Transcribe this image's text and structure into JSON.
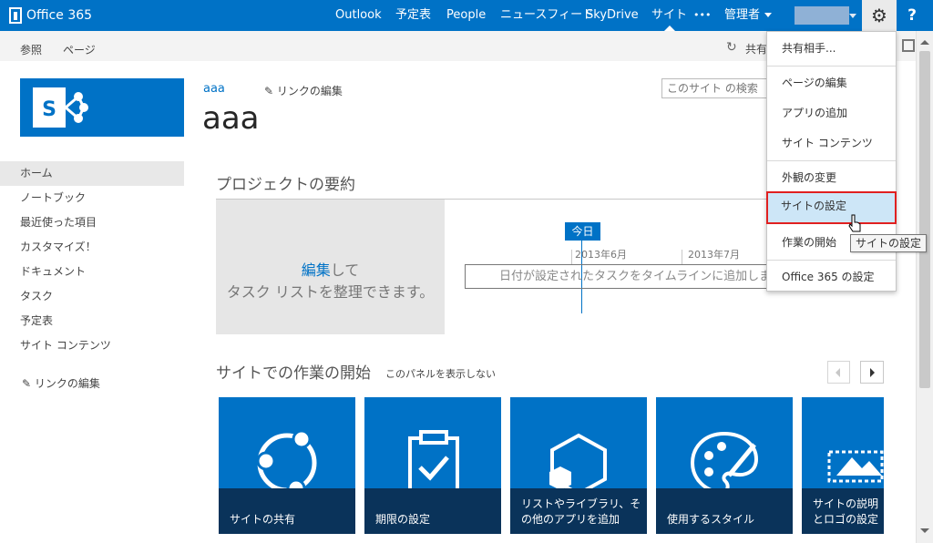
{
  "suite_bar": {
    "brand": "Office 365",
    "nav": [
      "Outlook",
      "予定表",
      "People",
      "ニュースフィード",
      "SkyDrive",
      "サイト",
      "•••"
    ],
    "active_nav": "サイト",
    "admin_label": "管理者",
    "help_label": "?"
  },
  "ribbon": {
    "tabs": [
      "参照",
      "ページ"
    ],
    "share_label": "共有"
  },
  "site": {
    "breadcrumb": "aaa",
    "edit_links": "リンクの編集",
    "title": "aaa",
    "search_placeholder": "このサイト の検索"
  },
  "quick_launch": {
    "items": [
      "ホーム",
      "ノートブック",
      "最近使った項目",
      "カスタマイズ！",
      "ドキュメント",
      "タスク",
      "予定表",
      "サイト コンテンツ"
    ],
    "selected": "ホーム",
    "edit_links": "リンクの編集"
  },
  "project_summary": {
    "heading": "プロジェクトの要約",
    "edit_link": "編集",
    "edit_suffix": "して",
    "line2": "タスク リストを整理できます。",
    "today_label": "今日",
    "months": [
      "2013年6月",
      "2013年7月"
    ],
    "timeline_text": "日付が設定されたタスクをタイムラインに追加しましょう。"
  },
  "getting_started": {
    "heading": "サイトでの作業の開始",
    "hide_link": "このパネルを表示しない",
    "tiles": [
      {
        "label": "サイトの共有",
        "icon": "share-site-icon"
      },
      {
        "label": "期限の設定",
        "icon": "clipboard-check-icon"
      },
      {
        "label": "リストやライブラリ、その他のアプリを追加",
        "icon": "add-apps-icon"
      },
      {
        "label": "使用するスタイル",
        "icon": "palette-brush-icon"
      },
      {
        "label": "サイトの説明とロゴの設定",
        "icon": "picture-frame-icon"
      }
    ]
  },
  "settings_menu": {
    "items": [
      "共有相手...",
      "ページの編集",
      "アプリの追加",
      "サイト コンテンツ",
      "外観の変更",
      "サイトの設定",
      "作業の開始",
      "Office 365 の設定"
    ],
    "highlighted": "サイトの設定"
  },
  "tooltip": "サイトの設定",
  "colors": {
    "brand_blue": "#0072c6",
    "tile_label_bg": "#0a335a",
    "highlight_border": "#e02020",
    "highlight_bg": "#cde6f7"
  }
}
